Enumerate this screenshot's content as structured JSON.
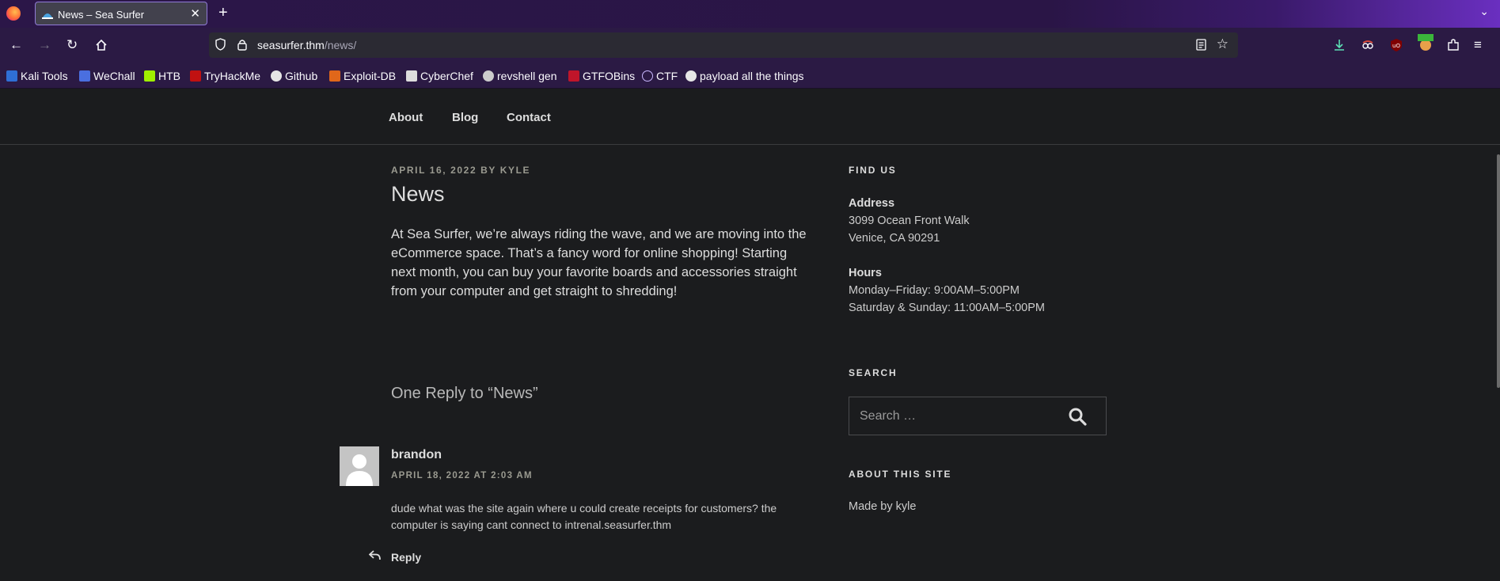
{
  "browser": {
    "tab_title": "News – Sea Surfer",
    "url_host": "seasurfer.thm",
    "url_path": "/news/",
    "bookmarks": [
      "Kali Tools",
      "WeChall",
      "HTB",
      "TryHackMe",
      "Github",
      "Exploit-DB",
      "CyberChef",
      "revshell gen",
      "GTFOBins",
      "CTF",
      "payload all the things"
    ]
  },
  "site_nav": {
    "items": [
      "About",
      "Blog",
      "Contact"
    ]
  },
  "post": {
    "meta": "APRIL 16, 2022 BY KYLE",
    "title": "News",
    "body": "At Sea Surfer, we’re always riding the wave, and we are moving into the eCommerce space. That’s a fancy word for online shopping! Starting next month, you can buy your favorite boards and accessories straight from your computer and get straight to shredding!"
  },
  "comments": {
    "heading": "One Reply to “News”",
    "items": [
      {
        "author": "brandon",
        "date": "APRIL 18, 2022 AT 2:03 AM",
        "text": "dude what was the site again where u could create receipts for customers? the computer is saying cant connect to intrenal.seasurfer.thm",
        "reply_label": "Reply"
      }
    ]
  },
  "sidebar": {
    "find_us": {
      "title": "FIND US",
      "address_label": "Address",
      "address_line1": "3099 Ocean Front Walk",
      "address_line2": "Venice, CA 90291",
      "hours_label": "Hours",
      "hours_line1": "Monday–Friday: 9:00AM–5:00PM",
      "hours_line2": "Saturday & Sunday: 11:00AM–5:00PM"
    },
    "search": {
      "title": "SEARCH",
      "placeholder": "Search …"
    },
    "about": {
      "title": "ABOUT THIS SITE",
      "text": "Made by kyle"
    }
  },
  "colors": {
    "page_bg": "#1b1c1e",
    "chrome_purple": "#2b1a44",
    "tab_bg": "#42414d",
    "muted_meta": "#9a9a90"
  }
}
